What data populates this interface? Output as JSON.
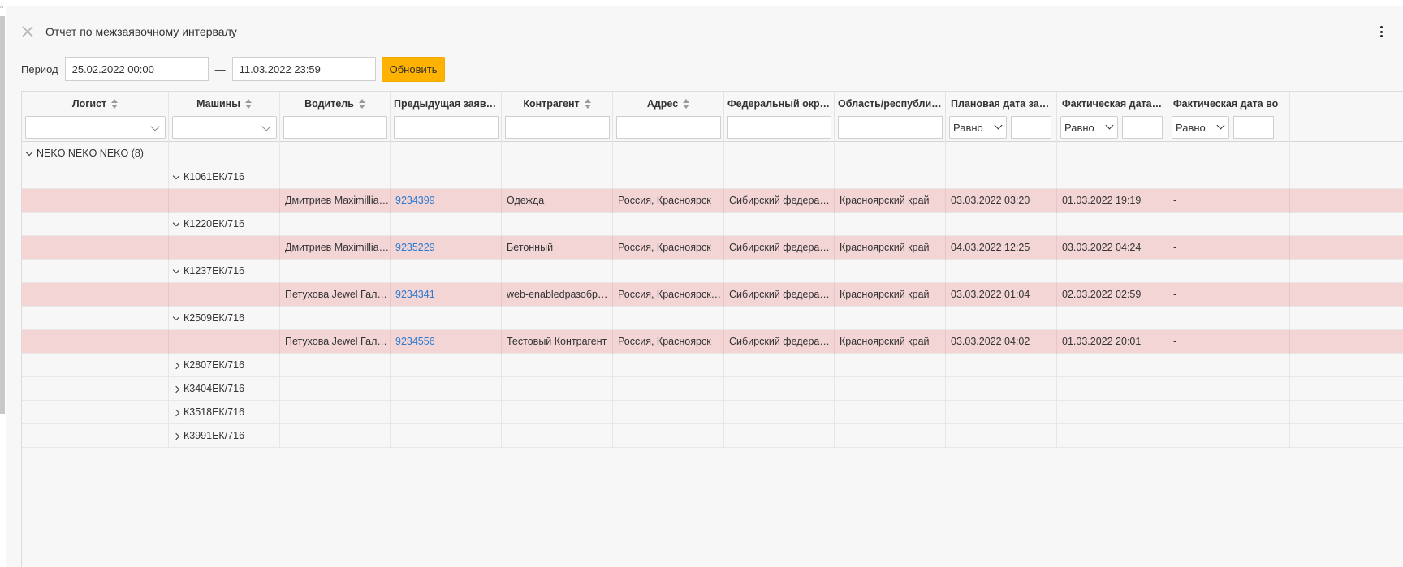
{
  "report": {
    "title": "Отчет по межзаявочному интервалу"
  },
  "period": {
    "label": "Период",
    "from": "25.02.2022 00:00",
    "to": "11.03.2022 23:59",
    "separator": "—",
    "refresh_label": "Обновить"
  },
  "colors": {
    "accent": "#ffb300",
    "highlight_row": "#f3d5d6",
    "link": "#2b7bd1"
  },
  "columns": [
    {
      "key": "logist",
      "label": "Логист",
      "filter": "select"
    },
    {
      "key": "cars",
      "label": "Машины",
      "filter": "select"
    },
    {
      "key": "driver",
      "label": "Водитель",
      "filter": "text"
    },
    {
      "key": "prev_order",
      "label": "Предыдущая заявка",
      "filter": "text"
    },
    {
      "key": "counterparty",
      "label": "Контрагент",
      "filter": "text"
    },
    {
      "key": "address",
      "label": "Адрес",
      "filter": "text"
    },
    {
      "key": "district",
      "label": "Федеральный округ",
      "filter": "text"
    },
    {
      "key": "region",
      "label": "Область/республика",
      "filter": "text"
    },
    {
      "key": "plan_date",
      "label": "Плановая дата заве...",
      "filter": "compare",
      "compare_value": "Равно"
    },
    {
      "key": "fact_date",
      "label": "Фактическая дата за...",
      "filter": "compare",
      "compare_value": "Равно"
    },
    {
      "key": "fact_return",
      "label": "Фактическая дата во",
      "filter": "compare",
      "compare_value": "Равно"
    }
  ],
  "group": {
    "label": "NEKO NEKO NEKO (8)"
  },
  "cars": [
    {
      "plate": "К1061ЕК/716",
      "expanded": true,
      "row": {
        "driver": "Дмитриев Maximillia ...",
        "order": "9234399",
        "counterparty": "Одежда",
        "address": "Россия, Красноярск",
        "district": "Сибирский федераль...",
        "region": "Красноярский край",
        "plan_date": "03.03.2022 03:20",
        "fact_date": "01.03.2022 19:19",
        "fact_return": "-"
      }
    },
    {
      "plate": "К1220ЕК/716",
      "expanded": true,
      "row": {
        "driver": "Дмитриев Maximillia ...",
        "order": "9235229",
        "counterparty": "Бетонный",
        "address": "Россия, Красноярск",
        "district": "Сибирский федераль...",
        "region": "Красноярский край",
        "plan_date": "04.03.2022 12:25",
        "fact_date": "03.03.2022 04:24",
        "fact_return": "-"
      }
    },
    {
      "plate": "К1237ЕК/716",
      "expanded": true,
      "row": {
        "driver": "Петухова Jewel Галкин",
        "order": "9234341",
        "counterparty": "web-enabledразобрать",
        "address": "Россия, Красноярск, Т...",
        "district": "Сибирский федераль...",
        "region": "Красноярский край",
        "plan_date": "03.03.2022 01:04",
        "fact_date": "02.03.2022 02:59",
        "fact_return": "-"
      }
    },
    {
      "plate": "К2509ЕК/716",
      "expanded": true,
      "row": {
        "driver": "Петухова Jewel Галкин",
        "order": "9234556",
        "counterparty": "Тестовый Контрагент",
        "address": "Россия, Красноярск",
        "district": "Сибирский федераль...",
        "region": "Красноярский край",
        "plan_date": "03.03.2022 04:02",
        "fact_date": "01.03.2022 20:01",
        "fact_return": "-"
      }
    },
    {
      "plate": "К2807ЕК/716",
      "expanded": false
    },
    {
      "plate": "К3404ЕК/716",
      "expanded": false
    },
    {
      "plate": "К3518ЕК/716",
      "expanded": false
    },
    {
      "plate": "К3991ЕК/716",
      "expanded": false
    }
  ]
}
